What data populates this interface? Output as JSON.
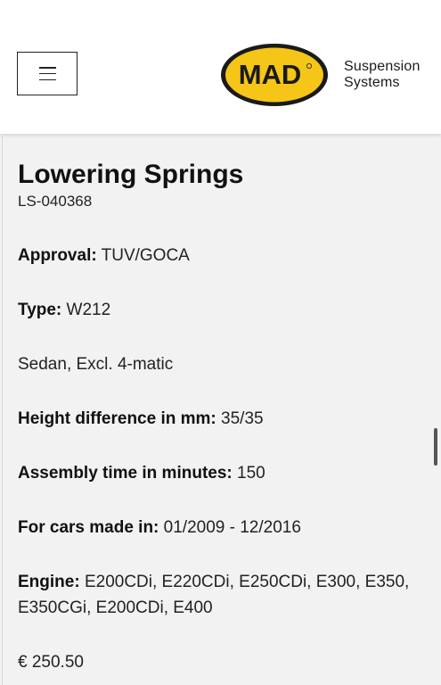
{
  "header": {
    "menu_button": "menu",
    "logo_mark": "MAD",
    "brand_line1": "Suspension",
    "brand_line2": "Systems",
    "brand_color": "#f5c518"
  },
  "product": {
    "title": "Lowering Springs",
    "sku": "LS-040368",
    "approval_label": "Approval:",
    "approval_value": "TUV/GOCA",
    "type_label": "Type:",
    "type_value": "W212",
    "body_variant": "Sedan, Excl. 4-matic",
    "height_label": "Height difference in mm:",
    "height_value": "35/35",
    "assembly_label": "Assembly time in minutes:",
    "assembly_value": "150",
    "years_label": "For cars made in:",
    "years_value": "01/2009 - 12/2016",
    "engine_label": "Engine:",
    "engine_value": "E200CDi, E220CDi, E250CDi, E300, E350, E350CGi, E200CDi, E400",
    "price": "€ 250.50"
  }
}
